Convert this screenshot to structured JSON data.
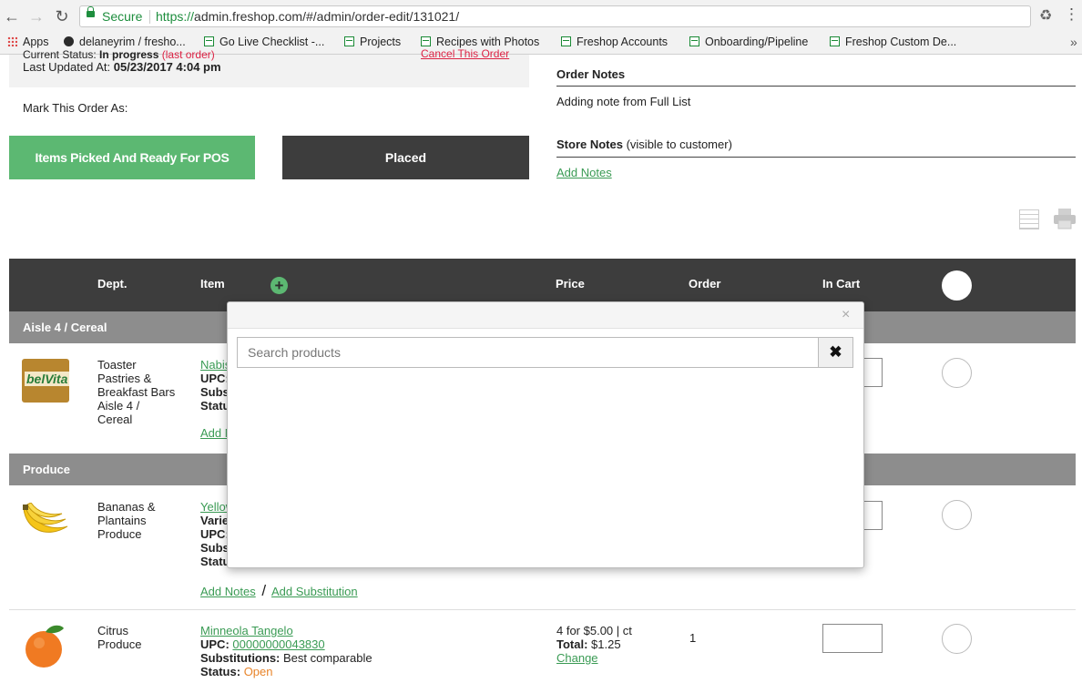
{
  "browser": {
    "secure_label": "Secure",
    "url_scheme": "https://",
    "url_rest": "admin.freshop.com/#/admin/order-edit/131021/",
    "bookmarks": [
      {
        "label": "Apps"
      },
      {
        "label": "delaneyrim / fresho..."
      },
      {
        "label": "Go Live Checklist -..."
      },
      {
        "label": "Projects"
      },
      {
        "label": "Recipes with Photos"
      },
      {
        "label": "Freshop Accounts"
      },
      {
        "label": "Onboarding/Pipeline"
      },
      {
        "label": "Freshop Custom De..."
      }
    ],
    "overflow": "»"
  },
  "order": {
    "status_label": "Current Status:",
    "status_value": "In progress",
    "status_extra": "(last order)",
    "cancel_label": "Cancel This Order",
    "last_updated_label": "Last Updated At:",
    "last_updated_value": "05/23/2017 4:04 pm",
    "mark_as_label": "Mark This Order As:",
    "btn_picked": "Items Picked And Ready For POS",
    "btn_placed": "Placed",
    "order_notes_heading": "Order Notes",
    "order_note_text": "Adding note from Full List",
    "store_notes_heading": "Store Notes",
    "store_notes_sub": "(visible to customer)",
    "add_notes": "Add Notes"
  },
  "table": {
    "headers": {
      "dept": "Dept.",
      "item": "Item",
      "price": "Price",
      "order": "Order",
      "in_cart": "In Cart"
    },
    "groups": [
      {
        "name": "Aisle 4 / Cereal"
      },
      {
        "name": "Produce"
      }
    ],
    "rows": [
      {
        "dept_lines": [
          "Toaster",
          "Pastries &",
          "Breakfast Bars",
          "Aisle 4 /",
          "Cereal"
        ],
        "item_name": "Nabis",
        "line2": "UPC:",
        "line3": "Subst",
        "line4": "Status",
        "add": "Add N",
        "thumb_text": "belVita"
      },
      {
        "dept_lines": [
          "Bananas &",
          "Plantains",
          "Produce"
        ],
        "item_name": "Yellow",
        "line2": "Varie",
        "line3": "UPC:",
        "line4": "Subst",
        "line5": "Status",
        "add_notes": "Add Notes",
        "sep": "/",
        "add_sub": "Add Substitution"
      },
      {
        "dept_lines": [
          "Citrus",
          "Produce"
        ],
        "item_name": "Minneola Tangelo",
        "upc_label": "UPC:",
        "upc": "00000000043830",
        "subs_label": "Substitutions:",
        "subs_value": "Best comparable",
        "status_label": "Status:",
        "status_value": "Open",
        "price_line": "4 for $5.00 | ct",
        "total_label": "Total:",
        "total_value": "$1.25",
        "change": "Change",
        "order_qty": "1"
      }
    ]
  },
  "modal": {
    "close": "×",
    "search_placeholder": "Search products",
    "clear": "✖"
  },
  "colors": {
    "accent_green": "#5cb872",
    "link_green": "#3a9b54",
    "header_dark": "#3d3d3d",
    "group_gray": "#8d8d8d",
    "status_open": "#e8842a"
  }
}
